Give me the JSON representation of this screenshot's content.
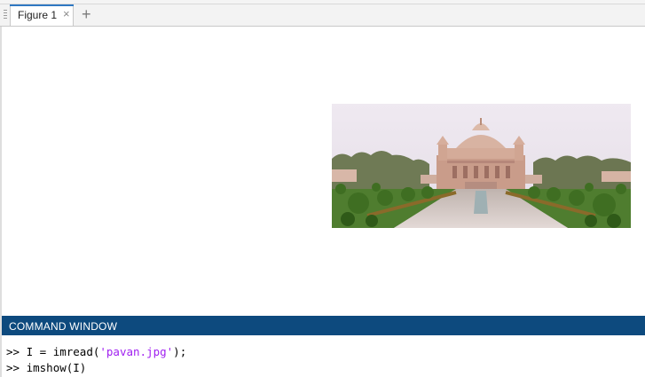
{
  "tabs": [
    {
      "label": "Figure 1",
      "close": "×"
    }
  ],
  "add_tab_glyph": "+",
  "figure": {
    "image_description_icon": "image-photo"
  },
  "command_window": {
    "title": "COMMAND WINDOW",
    "lines": [
      {
        "prompt": ">>",
        "code_before": " I = imread(",
        "string": "'pavan.jpg'",
        "code_after": ");"
      },
      {
        "prompt": ">>",
        "code": " imshow(I)"
      }
    ]
  },
  "colors": {
    "command_header_bg": "#0d4a7e",
    "tab_accent": "#2f78c2",
    "string_literal": "#a020f0"
  }
}
